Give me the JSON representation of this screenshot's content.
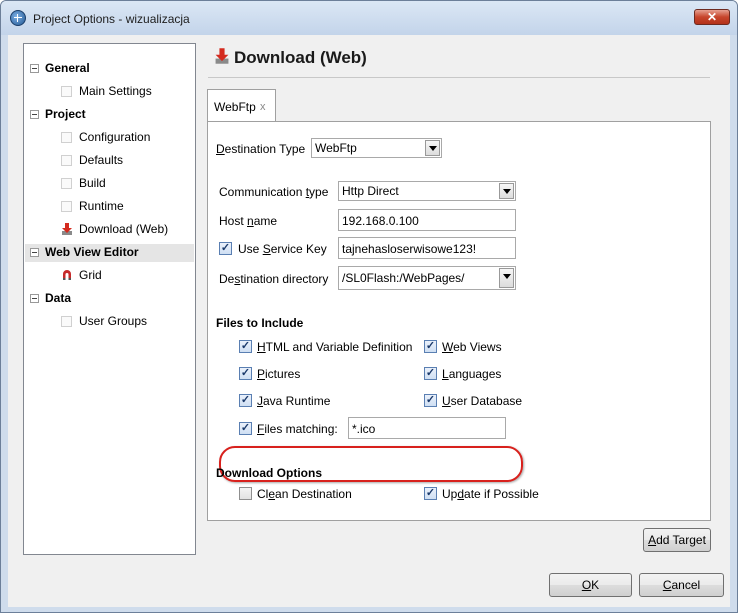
{
  "window": {
    "title": "Project Options - wizualizacja",
    "close_label": "✕"
  },
  "nav": {
    "general_label": "General",
    "main_settings_label": "Main Settings",
    "project_label": "Project",
    "configuration_label": "Configuration",
    "defaults_label": "Defaults",
    "build_label": "Build",
    "runtime_label": "Runtime",
    "download_web_label": "Download (Web)",
    "web_view_editor_label": "Web View Editor",
    "grid_label": "Grid",
    "data_label": "Data",
    "user_groups_label": "User Groups"
  },
  "header": {
    "title": "Download (Web)"
  },
  "tab": {
    "label": "WebFtp",
    "close": "x"
  },
  "form": {
    "destination_type": {
      "prefix": "D",
      "label": "estination Type",
      "value": "WebFtp"
    },
    "communication_type": {
      "label_a": "Communication ",
      "hot": "t",
      "label_b": "ype",
      "value": "Http Direct"
    },
    "host_name": {
      "label_a": "Host ",
      "hot": "n",
      "label_b": "ame",
      "value": "192.168.0.100"
    },
    "use_service_key": {
      "label_a": "Use ",
      "hot": "S",
      "label_b": "ervice Key",
      "checked": true,
      "value": "tajnehasloserwisowe123!"
    },
    "destination_directory": {
      "label_a": "De",
      "hot": "s",
      "label_b": "tination directory",
      "value": "/SL0Flash:/WebPages/"
    }
  },
  "files_to_include": {
    "title": "Files to Include",
    "html_var": {
      "hot": "H",
      "rest": "TML and Variable Definition",
      "checked": true
    },
    "web_views": {
      "hot": "W",
      "rest": "eb Views",
      "checked": true
    },
    "pictures": {
      "hot": "P",
      "rest": "ictures",
      "checked": true
    },
    "languages": {
      "hot": "L",
      "rest": "anguages",
      "checked": true
    },
    "java_runtime": {
      "hot": "J",
      "rest": "ava Runtime",
      "checked": true
    },
    "user_database": {
      "hot": "U",
      "rest": "ser Database",
      "checked": true
    },
    "files_matching": {
      "hot": "F",
      "rest": "iles matching:",
      "checked": true,
      "value": "*.ico"
    }
  },
  "download_options": {
    "title": "Download Options",
    "clean_destination": {
      "a": "Cl",
      "hot": "e",
      "b": "an Destination",
      "checked": false
    },
    "update_if_possible": {
      "a": "Up",
      "hot": "d",
      "b": "ate if Possible",
      "checked": true
    }
  },
  "buttons": {
    "add_target": {
      "hot": "A",
      "rest": "dd Target"
    },
    "ok": {
      "hot": "O",
      "rest": "K"
    },
    "cancel": {
      "hot": "C",
      "rest": "ancel"
    }
  },
  "colors": {
    "highlight": "#d8211d",
    "title_bar": "#cfdcec",
    "close": "#c7452c"
  },
  "icons": {
    "title": "globe-icon",
    "download": "download-arrow-icon",
    "grid": "grid-magnet-icon"
  }
}
